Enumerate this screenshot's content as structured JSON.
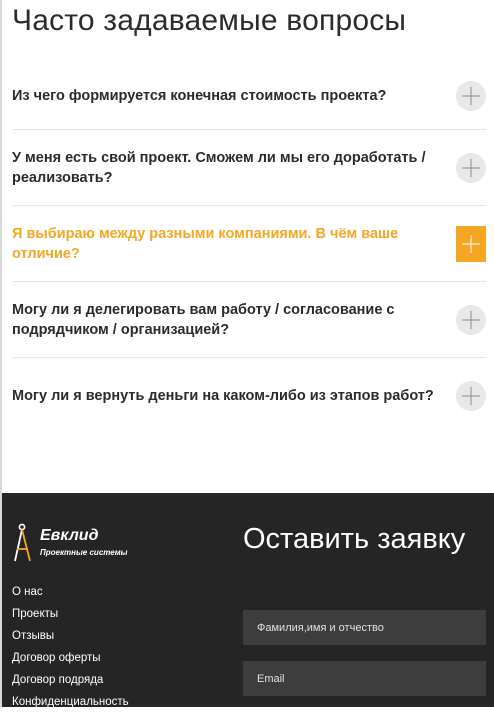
{
  "faq": {
    "title": "Часто задаваемые вопросы",
    "items": [
      {
        "question": "Из чего формируется конечная стоимость проекта?",
        "active": false
      },
      {
        "question": "У меня есть свой проект. Сможем ли мы его доработать / реализовать?",
        "active": false
      },
      {
        "question": "Я выбираю между разными компаниями. В чём ваше отличие?",
        "active": true
      },
      {
        "question": "Могу ли я делегировать вам работу / согласование с подрядчиком / организацией?",
        "active": false
      },
      {
        "question": "Могу ли я вернуть деньги на каком-либо из этапов работ?",
        "active": false
      }
    ]
  },
  "footer": {
    "logo": {
      "name": "Евклид",
      "subtitle": "Проектные системы",
      "icon": "compass-icon"
    },
    "nav": [
      "О нас",
      "Проекты",
      "Отзывы",
      "Договор оферты",
      "Договор подряда",
      "Конфиденциальность"
    ],
    "form": {
      "title": "Оставить заявку",
      "name_placeholder": "Фамилия,имя и отчество",
      "email_placeholder": "Email"
    }
  },
  "colors": {
    "accent": "#f5a623",
    "footer_bg": "#252525",
    "input_bg": "#3d3d3d",
    "text": "#2b2b2b"
  }
}
